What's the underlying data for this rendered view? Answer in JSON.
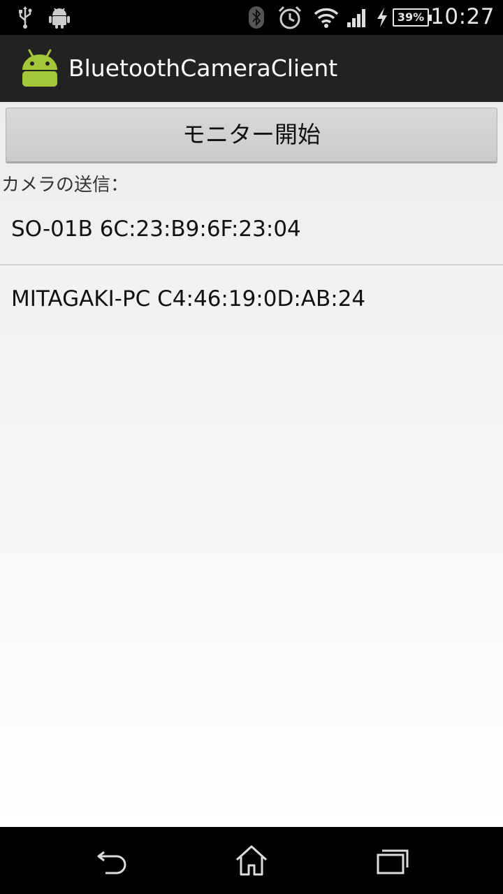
{
  "status_bar": {
    "icons": [
      "usb-icon",
      "android-debug-icon",
      "bluetooth-icon",
      "alarm-icon",
      "wifi-icon",
      "signal-icon",
      "charging-icon",
      "battery-icon"
    ],
    "battery_percent": "39%",
    "time": "10:27"
  },
  "action_bar": {
    "app_icon": "android-app-icon",
    "title": "BluetoothCameraClient"
  },
  "main": {
    "monitor_button_label": "モニター開始",
    "camera_label": "カメラの送信：",
    "devices": [
      {
        "label": "SO-01B 6C:23:B9:6F:23:04"
      },
      {
        "label": "MITAGAKI-PC C4:46:19:0D:AB:24"
      }
    ]
  },
  "nav_bar": {
    "icons": [
      "back-icon",
      "home-icon",
      "recent-apps-icon"
    ]
  },
  "colors": {
    "status_bar_bg": "#000000",
    "action_bar_bg": "#222222",
    "android_green": "#A4C639",
    "button_bg": "#D3D3D3"
  }
}
